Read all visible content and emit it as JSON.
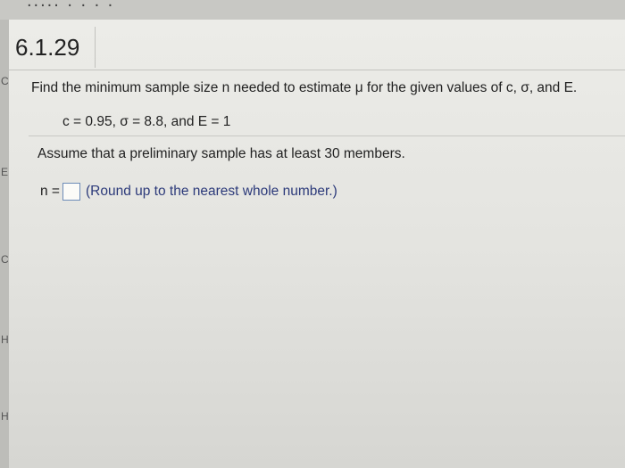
{
  "header": {
    "top_text": "..... . . . ."
  },
  "left_rail": {
    "letters": [
      "C",
      "E",
      "C",
      "H",
      "H"
    ]
  },
  "question": {
    "number": "6.1.29",
    "prompt": "Find the minimum sample size n needed to estimate μ for the given values of c, σ, and E.",
    "givens": "c = 0.95, σ = 8.8, and E = 1",
    "assumption": "Assume that a preliminary sample has at least 30 members."
  },
  "answer": {
    "label": "n =",
    "value": "",
    "hint": "(Round up to the nearest whole number.)"
  }
}
